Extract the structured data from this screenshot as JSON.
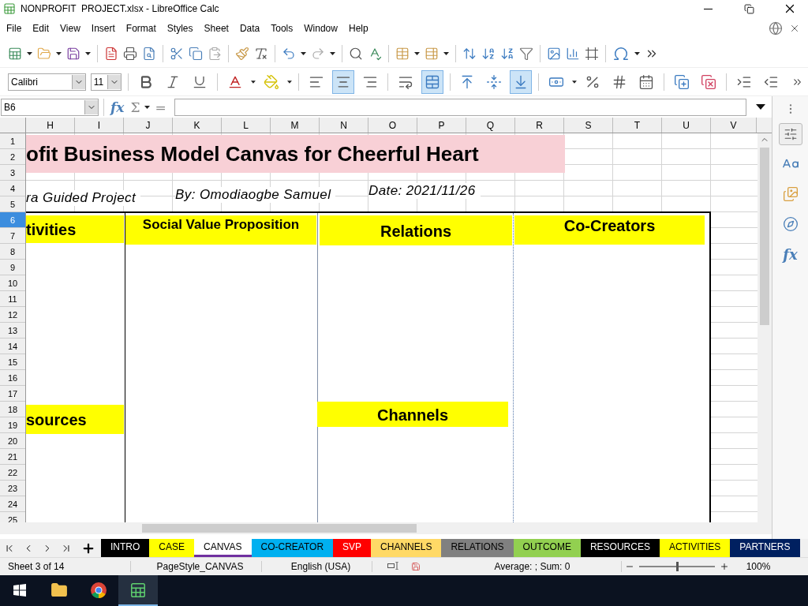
{
  "window": {
    "title": "NONPROFIT  PROJECT.xlsx - LibreOffice Calc"
  },
  "menu": [
    "File",
    "Edit",
    "View",
    "Insert",
    "Format",
    "Styles",
    "Sheet",
    "Data",
    "Tools",
    "Window",
    "Help"
  ],
  "format_toolbar": {
    "font_name": "Calibri",
    "font_size": "11",
    "horizontal_align": [
      {
        "selected": false
      },
      {
        "selected": true
      },
      {
        "selected": false
      }
    ],
    "vertical_align": [
      {
        "selected": false
      },
      {
        "selected": false
      },
      {
        "selected": true
      }
    ],
    "merge_center": true
  },
  "formula_bar": {
    "cell_reference": "B6",
    "function_label": "fx",
    "sum_label": "Σ",
    "equals_label": "="
  },
  "sidebar": {
    "functions_label": "fx"
  },
  "columns": [
    "H",
    "I",
    "J",
    "K",
    "L",
    "M",
    "N",
    "O",
    "P",
    "Q",
    "R",
    "S",
    "T",
    "U",
    "V"
  ],
  "rows": [
    {
      "label": "1",
      "selected": false
    },
    {
      "label": "2",
      "selected": false
    },
    {
      "label": "3",
      "selected": false
    },
    {
      "label": "4",
      "selected": false
    },
    {
      "label": "5",
      "selected": false
    },
    {
      "label": "6",
      "selected": true
    },
    {
      "label": "7",
      "selected": false
    },
    {
      "label": "8",
      "selected": false
    },
    {
      "label": "9",
      "selected": false
    },
    {
      "label": "10",
      "selected": false
    },
    {
      "label": "11",
      "selected": false
    },
    {
      "label": "12",
      "selected": false
    },
    {
      "label": "13",
      "selected": false
    },
    {
      "label": "14",
      "selected": false
    },
    {
      "label": "15",
      "selected": false
    },
    {
      "label": "16",
      "selected": false
    },
    {
      "label": "17",
      "selected": false
    },
    {
      "label": "18",
      "selected": false
    },
    {
      "label": "19",
      "selected": false
    },
    {
      "label": "20",
      "selected": false
    },
    {
      "label": "21",
      "selected": false
    },
    {
      "label": "22",
      "selected": false
    },
    {
      "label": "23",
      "selected": false
    },
    {
      "label": "24",
      "selected": false
    },
    {
      "label": "25",
      "selected": false
    }
  ],
  "canvas": {
    "title": "ofit Business Model Canvas for Cheerful Heart",
    "subtitles": [
      "ra Guided Project",
      "By: Omodiaogbe Samuel",
      "Date: 2021/11/26"
    ],
    "blocks": [
      {
        "label": "tivities",
        "kind": "header"
      },
      {
        "label": "Social Value Proposition",
        "kind": "header"
      },
      {
        "label": "Relations",
        "kind": "header"
      },
      {
        "label": "Co-Creators",
        "kind": "header"
      },
      {
        "label": "sources",
        "kind": "header"
      },
      {
        "label": "Channels",
        "kind": "header"
      }
    ]
  },
  "sheet_tabs": [
    {
      "label": "INTRO",
      "color": "#000000",
      "selected": false
    },
    {
      "label": "CASE",
      "color": "#ffff00",
      "selected": false
    },
    {
      "label": "CANVAS",
      "color": "#ffffff",
      "selected": true
    },
    {
      "label": "CO-CREATOR",
      "color": "#00b0f0",
      "selected": false
    },
    {
      "label": "SVP",
      "color": "#ff0000",
      "selected": false
    },
    {
      "label": "CHANNELS",
      "color": "#ffd966",
      "selected": false
    },
    {
      "label": "RELATIONS",
      "color": "#808080",
      "selected": false
    },
    {
      "label": "OUTCOME",
      "color": "#92d050",
      "selected": false
    },
    {
      "label": "RESOURCES",
      "color": "#000000",
      "selected": false
    },
    {
      "label": "ACTIVITIES",
      "color": "#ffff00",
      "selected": false
    },
    {
      "label": "PARTNERS",
      "color": "#002060",
      "selected": false
    }
  ],
  "status_bar": {
    "sheet": "Sheet 3 of 14",
    "page_style": "PageStyle_CANVAS",
    "language": "English (USA)",
    "summary": "Average: ; Sum: 0",
    "zoom": {
      "level": 0.5
    },
    "zoom_reading": "100%"
  }
}
